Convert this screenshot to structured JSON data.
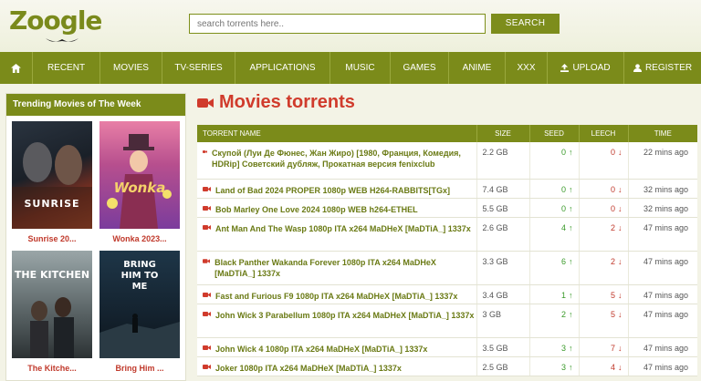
{
  "logo": {
    "text": "Zoogle"
  },
  "search": {
    "placeholder": "search torrents here..",
    "button_label": "SEARCH"
  },
  "nav": {
    "items": [
      {
        "label": "",
        "icon": "home-icon"
      },
      {
        "label": "RECENT"
      },
      {
        "label": "MOVIES"
      },
      {
        "label": "TV-SERIES"
      },
      {
        "label": "APPLICATIONS"
      },
      {
        "label": "MUSIC"
      },
      {
        "label": "GAMES"
      },
      {
        "label": "ANIME"
      },
      {
        "label": "XXX"
      },
      {
        "label": "UPLOAD",
        "icon": "upload-icon"
      },
      {
        "label": "REGISTER",
        "icon": "user-icon"
      }
    ]
  },
  "sidebar": {
    "title": "Trending Movies of The Week",
    "posters": [
      {
        "caption": "Sunrise 20...",
        "art_text": "SUNRISE"
      },
      {
        "caption": "Wonka 2023...",
        "art_text": "Wonka"
      },
      {
        "caption": "The Kitche...",
        "art_text": "THE KITCHEN"
      },
      {
        "caption": "Bring Him ...",
        "art_text": "BRING HIM TO ME"
      }
    ]
  },
  "main": {
    "title": "Movies torrents",
    "headers": {
      "name": "TORRENT NAME",
      "size": "SIZE",
      "seed": "SEED",
      "leech": "LEECH",
      "time": "TIME"
    },
    "rows": [
      {
        "name": "Скупой (Луи Де Фюнес, Жан Жиро) [1980, Франция, Комедия, HDRip] Советский дубляж, Прокатная версия fenixclub",
        "size": "2.2 GB",
        "seed": "0",
        "leech": "0",
        "time": "22 mins ago"
      },
      {
        "name": "Land of Bad 2024 PROPER 1080p WEB H264-RABBITS[TGx]",
        "size": "7.4 GB",
        "seed": "0",
        "leech": "0",
        "time": "32 mins ago"
      },
      {
        "name": "Bob Marley One Love 2024 1080p WEB h264-ETHEL",
        "size": "5.5 GB",
        "seed": "0",
        "leech": "0",
        "time": "32 mins ago"
      },
      {
        "name": "Ant Man And The Wasp 1080p ITA x264 MaDHeX [MaDTiA_] 1337x",
        "size": "2.6 GB",
        "seed": "4",
        "leech": "2",
        "time": "47 mins ago"
      },
      {
        "name": "Black Panther Wakanda Forever 1080p ITA x264 MaDHeX [MaDTiA_] 1337x",
        "size": "3.3 GB",
        "seed": "6",
        "leech": "2",
        "time": "47 mins ago"
      },
      {
        "name": "Fast and Furious F9 1080p ITA x264 MaDHeX [MaDTiA_] 1337x",
        "size": "3.4 GB",
        "seed": "1",
        "leech": "5",
        "time": "47 mins ago"
      },
      {
        "name": "John Wick 3 Parabellum 1080p ITA x264 MaDHeX [MaDTiA_] 1337x",
        "size": "3 GB",
        "seed": "2",
        "leech": "5",
        "time": "47 mins ago"
      },
      {
        "name": "John Wick 4 1080p ITA x264 MaDHeX [MaDTiA_] 1337x",
        "size": "3.5 GB",
        "seed": "3",
        "leech": "7",
        "time": "47 mins ago"
      },
      {
        "name": "Joker 1080p ITA x264 MaDHeX [MaDTiA_] 1337x",
        "size": "2.5 GB",
        "seed": "3",
        "leech": "4",
        "time": "47 mins ago"
      }
    ]
  },
  "colors": {
    "accent": "#7b8b1a",
    "title_red": "#d03b2c",
    "seed_green": "#3a9a2a",
    "leech_red": "#c0392b"
  }
}
